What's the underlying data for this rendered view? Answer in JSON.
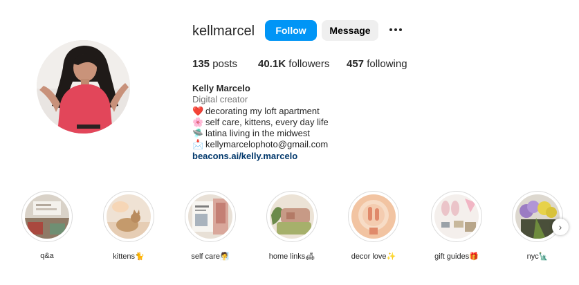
{
  "profile": {
    "username": "kellmarcel",
    "follow_label": "Follow",
    "message_label": "Message",
    "more_icon": "more-options-icon"
  },
  "stats": {
    "posts_count": "135",
    "posts_label": "posts",
    "followers_count": "40.1K",
    "followers_label": "followers",
    "following_count": "457",
    "following_label": "following"
  },
  "bio": {
    "name": "Kelly Marcelo",
    "category": "Digital creator",
    "lines": [
      {
        "emoji": "❤️",
        "text": "decorating my loft apartment"
      },
      {
        "emoji": "🌸",
        "text": "self care, kittens, every day life"
      },
      {
        "emoji": "🛸",
        "text": "latina living in the midwest"
      },
      {
        "emoji": "📩",
        "text": "kellymarcelophoto@gmail.com"
      }
    ],
    "link": "beacons.ai/kelly.marcelo"
  },
  "highlights": [
    {
      "label": "q&a"
    },
    {
      "label": "kittens🐈"
    },
    {
      "label": "self care🧖"
    },
    {
      "label": "home links🛋"
    },
    {
      "label": "decor love✨"
    },
    {
      "label": "gift guides🎁"
    },
    {
      "label": "nyc🗽"
    }
  ],
  "colors": {
    "follow_button": "#0095f6",
    "message_button": "#efefef",
    "link": "#00376b",
    "category_text": "#737373"
  }
}
